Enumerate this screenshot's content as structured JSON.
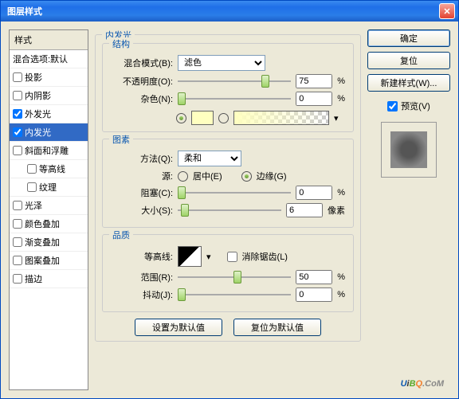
{
  "window_title": "图层样式",
  "styles": {
    "header": "样式",
    "blend_defaults": "混合选项:默认",
    "drop_shadow": "投影",
    "inner_shadow": "内阴影",
    "outer_glow": "外发光",
    "inner_glow": "内发光",
    "bevel_emboss": "斜面和浮雕",
    "contour": "等高线",
    "texture": "纹理",
    "satin": "光泽",
    "color_overlay": "颜色叠加",
    "gradient_overlay": "渐变叠加",
    "pattern_overlay": "图案叠加",
    "stroke": "描边"
  },
  "panel": {
    "title": "内发光",
    "structure": "结构",
    "blend_mode_lbl": "混合模式(B):",
    "blend_mode_val": "滤色",
    "opacity_lbl": "不透明度(O):",
    "opacity_val": "75",
    "pct": "%",
    "noise_lbl": "杂色(N):",
    "noise_val": "0",
    "color_solid": "#FFFFC0",
    "elements": "图素",
    "technique_lbl": "方法(Q):",
    "technique_val": "柔和",
    "source_lbl": "源:",
    "source_center": "居中(E)",
    "source_edge": "边缘(G)",
    "choke_lbl": "阻塞(C):",
    "choke_val": "0",
    "size_lbl": "大小(S):",
    "size_val": "6",
    "px": "像素",
    "quality": "品质",
    "contour_lbl": "等高线:",
    "antialias": "消除锯齿(L)",
    "range_lbl": "范围(R):",
    "range_val": "50",
    "jitter_lbl": "抖动(J):",
    "jitter_val": "0",
    "make_default": "设置为默认值",
    "reset_default": "复位为默认值"
  },
  "buttons": {
    "ok": "确定",
    "cancel": "复位",
    "new_style": "新建样式(W)...",
    "preview": "预览(V)"
  },
  "watermark": {
    "u": "U",
    "i": "i",
    "b": "B",
    "q": "Q",
    "rest": ".CoM"
  }
}
